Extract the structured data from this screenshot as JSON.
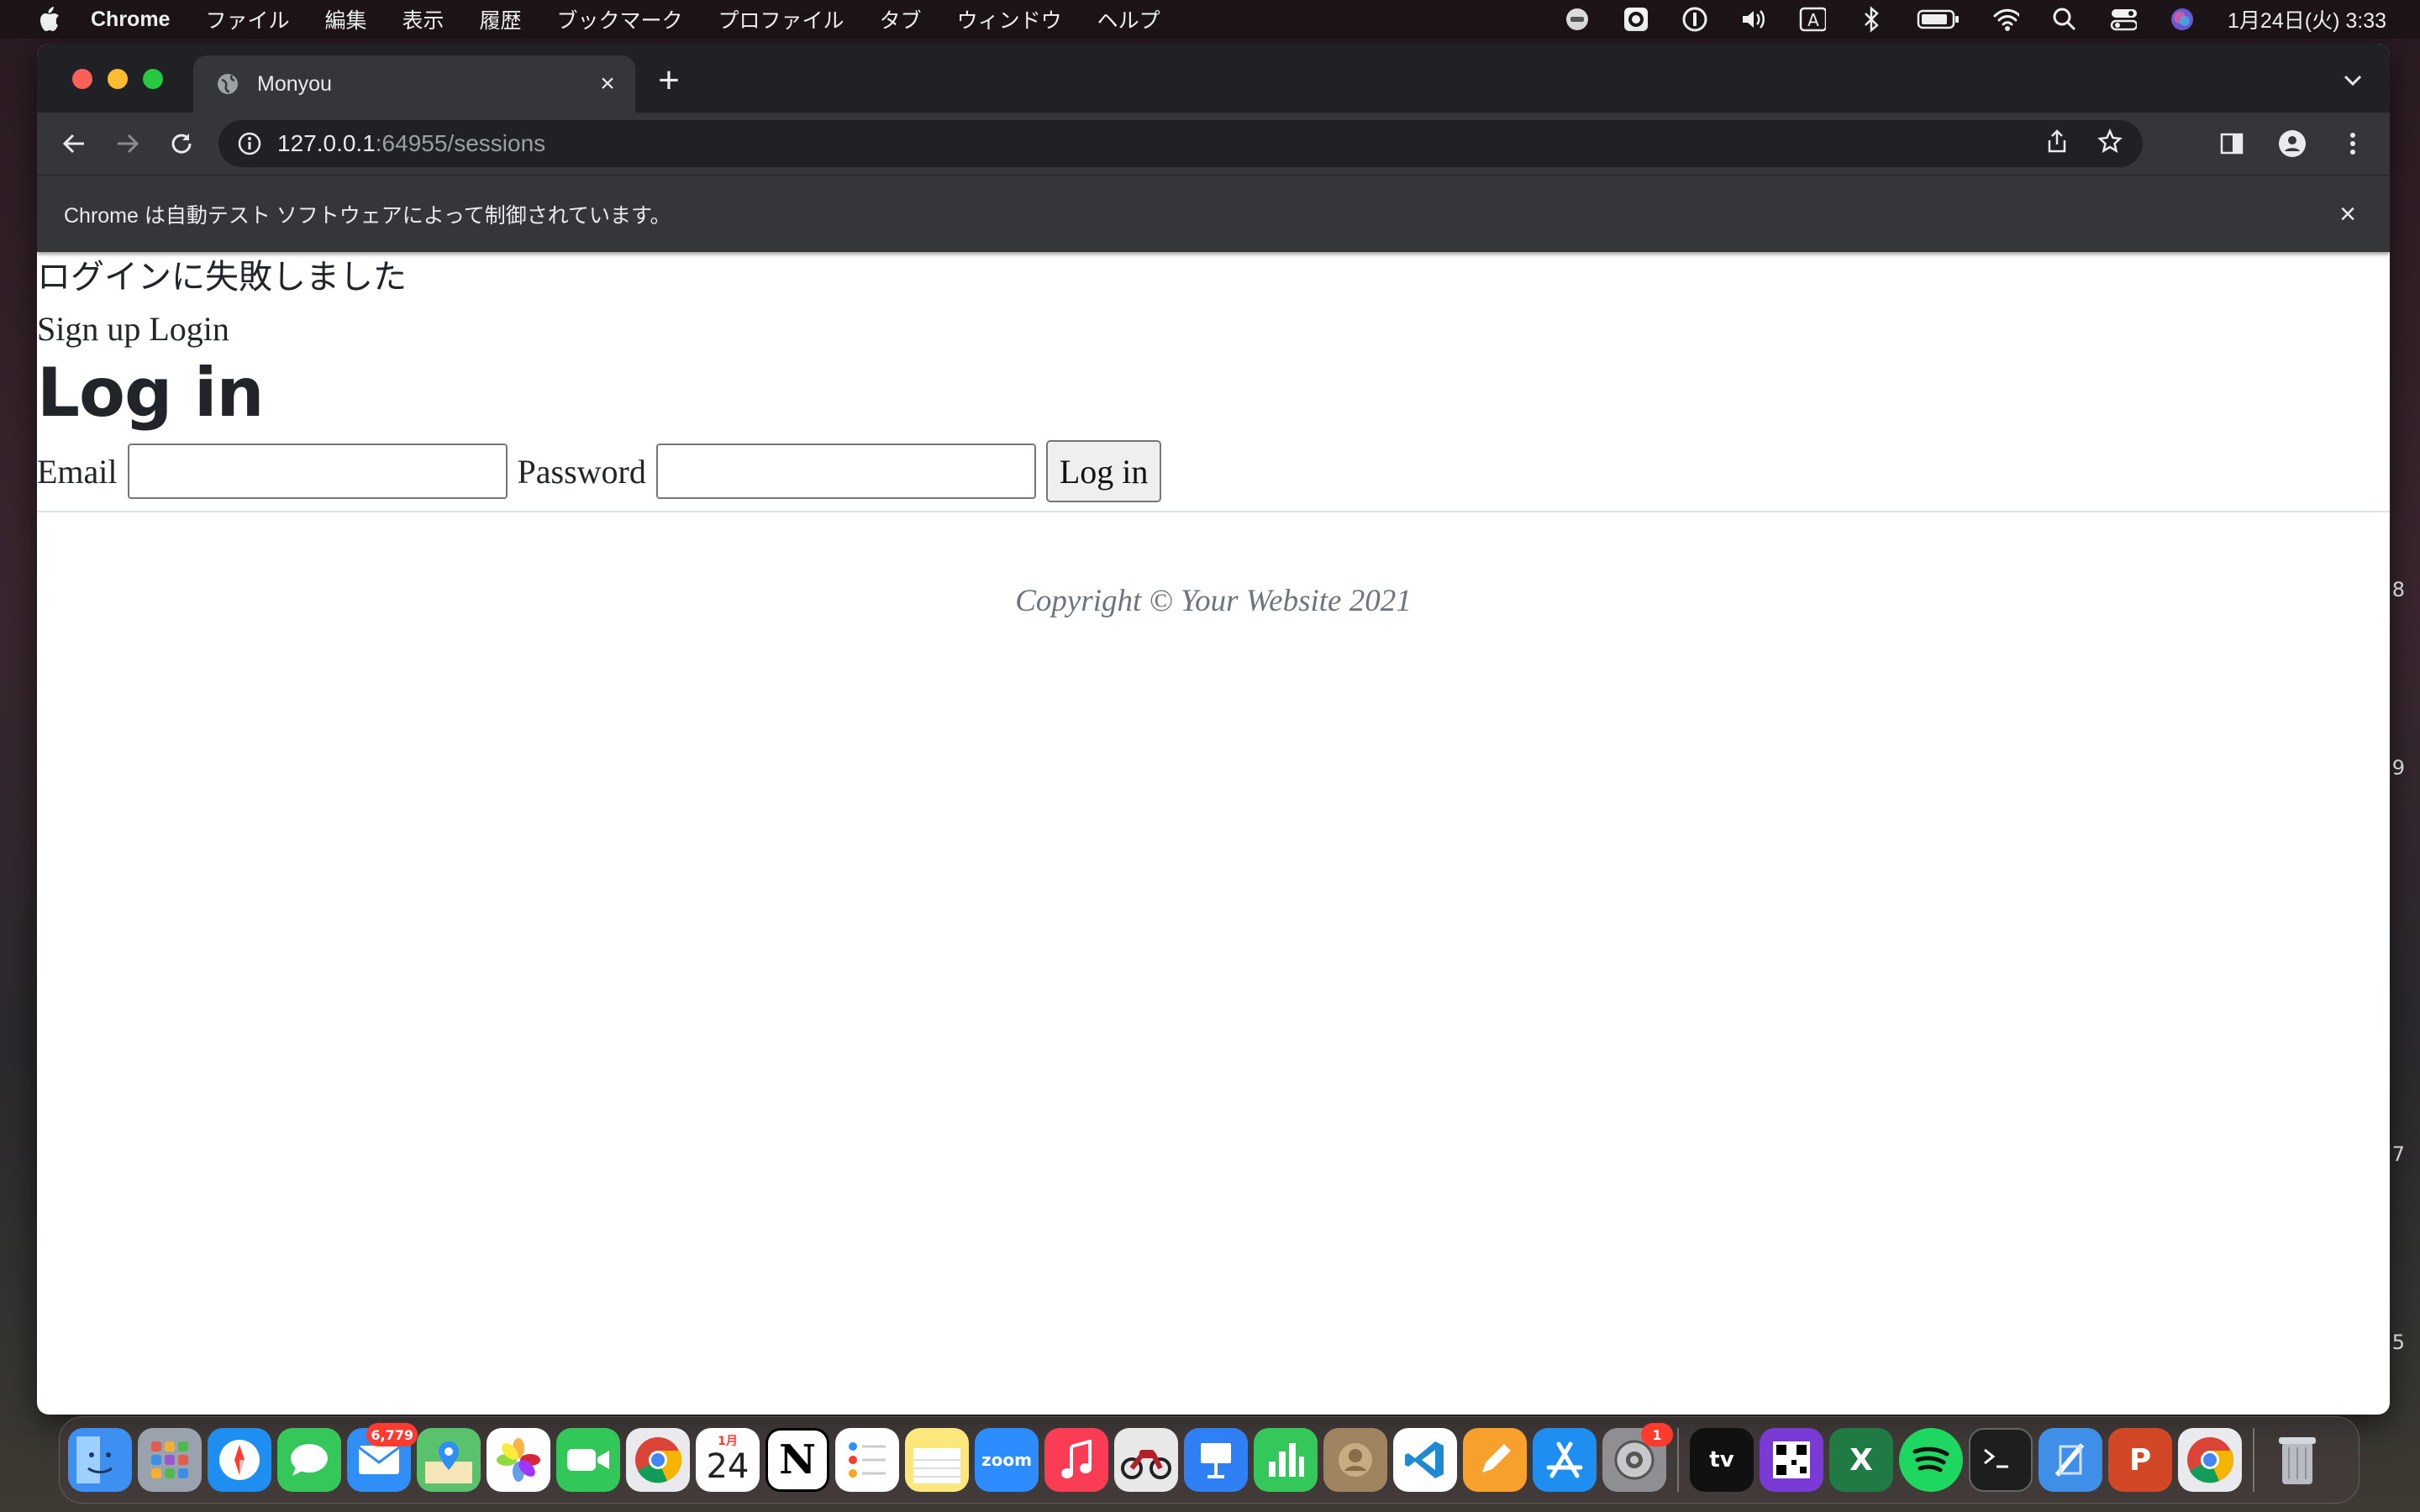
{
  "menubar": {
    "app_name": "Chrome",
    "items": [
      "ファイル",
      "編集",
      "表示",
      "履歴",
      "ブックマーク",
      "プロファイル",
      "タブ",
      "ウィンドウ",
      "ヘルプ"
    ],
    "clock": "1月24日(火) 3:33",
    "input_source": "A"
  },
  "browser": {
    "tab_title": "Monyou",
    "url_host": "127.0.0.1",
    "url_rest": ":64955/sessions",
    "infobar_message": "Chrome は自動テスト ソフトウェアによって制御されています。"
  },
  "page": {
    "flash": "ログインに失敗しました",
    "nav_signup": "Sign up",
    "nav_login": "Login",
    "heading": "Log in",
    "email_label": "Email",
    "email_value": "",
    "password_label": "Password",
    "password_value": "",
    "submit_label": "Log in",
    "copyright": "Copyright © Your Website 2021"
  },
  "dock": {
    "mail_badge": "6,779",
    "calendar_month": "1月",
    "calendar_day": "24",
    "settings_badge": "1",
    "zoom_label": "zoom",
    "tv_label": "tv",
    "notion_label": "N",
    "excel_label": "X",
    "ppt_label": "P",
    "colors": {
      "finder": "#3d8ff2",
      "launchpad": "#9aa3ad",
      "safari": "#1f8ef1",
      "messages": "#35c759",
      "mail": "#2f8ff7",
      "maps": "#5ac16c",
      "photos": "#f2c94c",
      "facetime": "#32c759",
      "chrome": "#e8eaed",
      "calendar": "#ffffff",
      "notion": "#ffffff",
      "reminders": "#ffffff",
      "notes": "#fce77d",
      "zoom": "#2d8cff",
      "music": "#fa3c54",
      "moto": "#e8e8e8",
      "keynote": "#2f7ff5",
      "numbers": "#34c759",
      "contacts": "#a0845f",
      "vscode": "#1f8ad2",
      "pages": "#f7a02c",
      "appstore": "#1f8ef1",
      "settings": "#8e8e93",
      "tv": "#111111",
      "qr": "#7a3ad6",
      "excel": "#1f7a44",
      "spotify": "#1ed760",
      "terminal": "#1e1e1e",
      "xcode": "#3f8fe8",
      "powerpoint": "#d24726",
      "chrome2": "#e8eaed",
      "trash": "#b8bcc2"
    }
  },
  "side_digits": [
    "8",
    "9",
    "7",
    "5"
  ]
}
